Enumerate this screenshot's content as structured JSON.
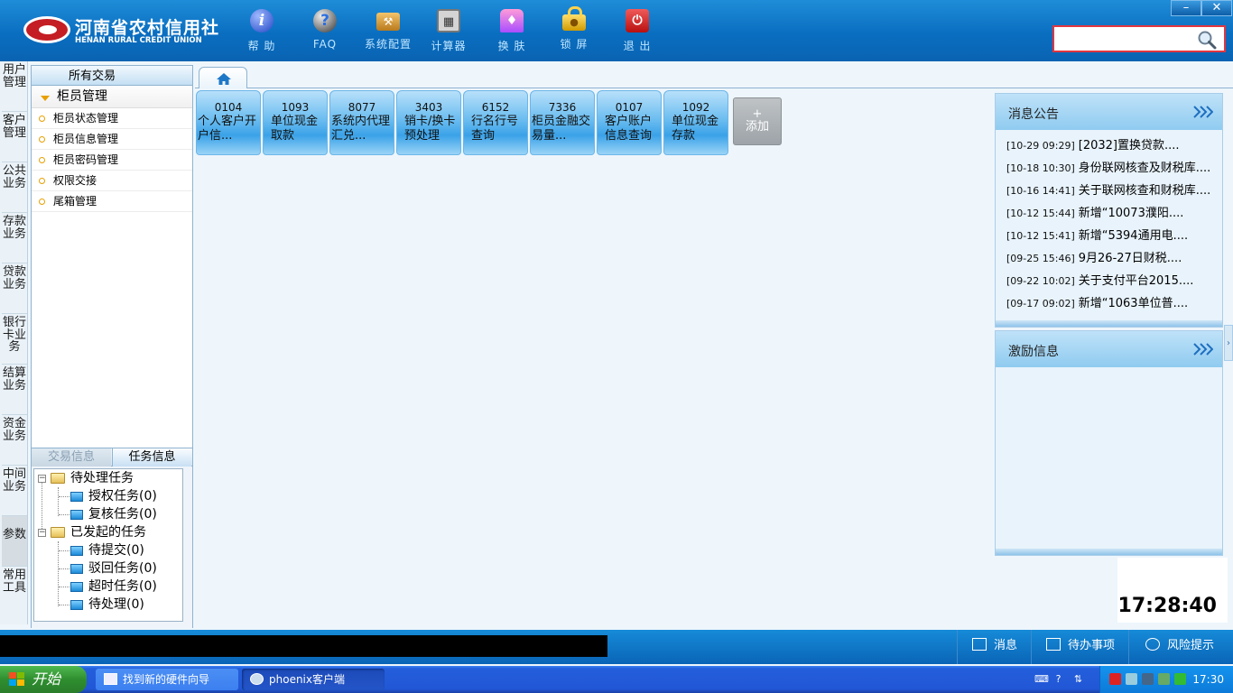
{
  "app": {
    "logo_cn": "河南省农村信用社",
    "logo_en": "HENAN RURAL CREDIT UNION"
  },
  "toolbar": [
    {
      "label": "帮 助",
      "icon": "help-icon"
    },
    {
      "label": "FAQ",
      "icon": "faq-icon"
    },
    {
      "label": "系统配置",
      "icon": "settings-toolbox-icon"
    },
    {
      "label": "计算器",
      "icon": "calculator-icon"
    },
    {
      "label": "换 肤",
      "icon": "skin-shirt-icon"
    },
    {
      "label": "锁 屏",
      "icon": "lock-icon"
    },
    {
      "label": "退 出",
      "icon": "exit-power-icon"
    }
  ],
  "window_controls": {
    "minimize": "–",
    "close": "✕"
  },
  "search": {
    "value": "",
    "placeholder": ""
  },
  "vertical_nav": [
    "用户管理",
    "客户管理",
    "公共业务",
    "存款业务",
    "贷款业务",
    "银行卡业务",
    "结算业务",
    "资金业务",
    "中间业务",
    "参数",
    "常用工具"
  ],
  "left_panel": {
    "all_tab": "所有交易",
    "group_title": "柜员管理",
    "items": [
      "柜员状态管理",
      "柜员信息管理",
      "柜员密码管理",
      "权限交接",
      "尾箱管理"
    ],
    "bottom_tabs": [
      "交易信息",
      "任务信息"
    ],
    "tree": {
      "pending": {
        "label": "待处理任务",
        "children": [
          "授权任务(0)",
          "复核任务(0)"
        ]
      },
      "initiated": {
        "label": "已发起的任务",
        "children": [
          "待提交(0)",
          "驳回任务(0)",
          "超时任务(0)",
          "待处理(0)"
        ]
      }
    }
  },
  "tiles": [
    {
      "code": "0104",
      "name": "个人客户开户信..."
    },
    {
      "code": "1093",
      "name": "单位现金取款"
    },
    {
      "code": "8077",
      "name": "系统内代理汇兑..."
    },
    {
      "code": "3403",
      "name": "销卡/换卡预处理"
    },
    {
      "code": "6152",
      "name": "行名行号查询"
    },
    {
      "code": "7336",
      "name": "柜员金融交易量..."
    },
    {
      "code": "0107",
      "name": "客户账户信息查询"
    },
    {
      "code": "1092",
      "name": "单位现金存款"
    }
  ],
  "add_tile": {
    "plus": "+",
    "label": "添加"
  },
  "news_panel": {
    "title": "消息公告",
    "items": [
      {
        "time": "[10-29 09:29]",
        "text": "[2032]置换贷款...."
      },
      {
        "time": "[10-18 10:30]",
        "text": "身份联网核查及财税库...."
      },
      {
        "time": "[10-16 14:41]",
        "text": "关于联网核查和财税库...."
      },
      {
        "time": "[10-12 15:44]",
        "text": "新增“10073濮阳...."
      },
      {
        "time": "[10-12 15:41]",
        "text": "新增“5394通用电...."
      },
      {
        "time": "[09-25 15:46]",
        "text": "9月26-27日财税...."
      },
      {
        "time": "[09-22 10:02]",
        "text": "关于支付平台2015...."
      },
      {
        "time": "[09-17 09:02]",
        "text": "新增“1063单位普...."
      }
    ]
  },
  "incentive_panel": {
    "title": "激励信息"
  },
  "clock": "17:28:40",
  "status_buttons": [
    "消息",
    "待办事项",
    "风险提示"
  ],
  "taskbar": {
    "start": "开始",
    "tasks": [
      "找到新的硬件向导",
      "phoenix客户端"
    ],
    "tray_time": "17:30"
  },
  "colors": {
    "topbar": "#0a6ec0",
    "accent_red": "#e23640",
    "tile_blue": "#6bbdf0",
    "taskbar_blue": "#245edb",
    "start_green": "#2f8e2f"
  }
}
